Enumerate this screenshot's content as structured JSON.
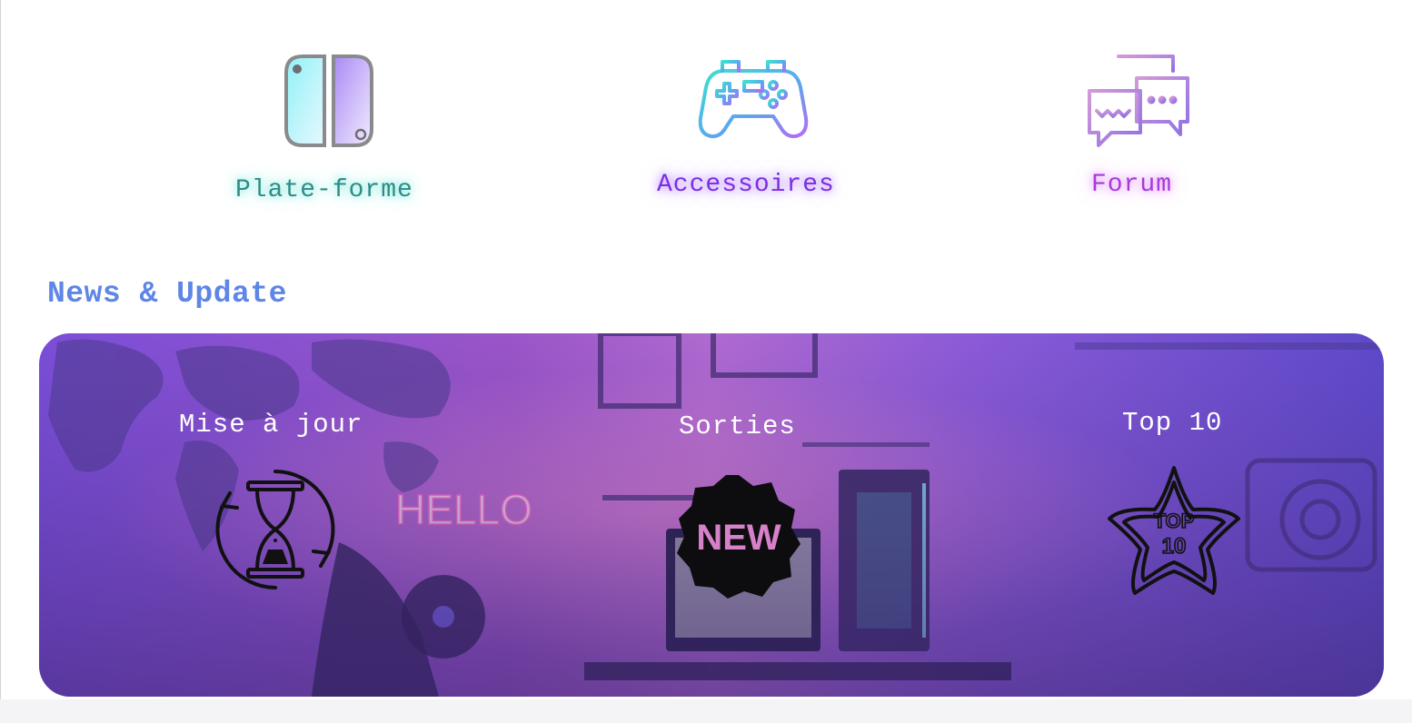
{
  "nav": {
    "categories": [
      {
        "label": "Plate-forme",
        "icon": "switch-console-icon"
      },
      {
        "label": "Accessoires",
        "icon": "gamepad-icon"
      },
      {
        "label": "Forum",
        "icon": "chat-bubbles-icon"
      }
    ]
  },
  "news": {
    "title": "News & Update",
    "banner_image": "neon-gaming-room",
    "items": [
      {
        "label": "Mise à jour",
        "icon": "hourglass-refresh-icon"
      },
      {
        "label": "Sorties",
        "icon": "new-badge-icon",
        "badge_text": "NEW"
      },
      {
        "label": "Top 10",
        "icon": "top10-star-icon",
        "badge_text": "TOP 10"
      }
    ]
  },
  "colors": {
    "heading": "#5e86e6",
    "platform_label": "#2f8c86",
    "accessories_label": "#7b2fe0",
    "forum_label": "#a63bd6",
    "banner_overlay": "#6a3fd0"
  }
}
